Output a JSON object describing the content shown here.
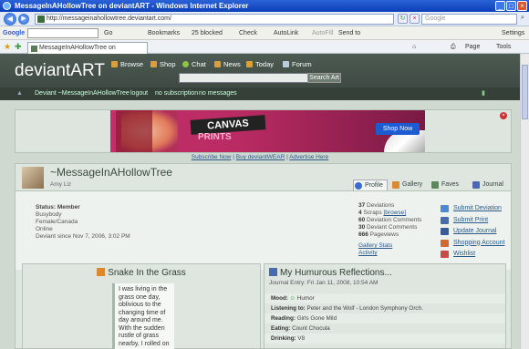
{
  "window": {
    "title": "MessageInAHollowTree on deviantART - Windows Internet Explorer"
  },
  "address": {
    "url": "http://messageinahollowtree.deviantart.com/",
    "search_placeholder": "Google"
  },
  "google_bar": {
    "brand": "Google",
    "go": "Go",
    "bookmarks": "Bookmarks",
    "blocked": "25 blocked",
    "check": "Check",
    "autolink": "AutoLink",
    "autofill": "AutoFill",
    "sendto": "Send to",
    "settings": "Settings"
  },
  "tab": {
    "label": "MessageInAHollowTree on deviantART"
  },
  "commands": {
    "page": "Page",
    "tools": "Tools"
  },
  "site": {
    "logo": "deviantART",
    "nav": [
      "Browse",
      "Shop",
      "Chat",
      "News",
      "Today",
      "Forum"
    ],
    "search_button": "Search Art"
  },
  "userbar": {
    "user": "Deviant ~MessageInAHollowTree",
    "logout": "logout",
    "subscription": "no subscription",
    "messages": "no messages"
  },
  "ad": {
    "canvas": "CANVAS",
    "prints": "PRINTS",
    "shop": "Shop Now",
    "links": [
      "Subscribe Now",
      "Buy deviantWEAR",
      "Advertise Here"
    ]
  },
  "profile": {
    "name": "~MessageInAHollowTree",
    "realname": "Amy Liz",
    "tabs": [
      "Profile",
      "Gallery",
      "Faves",
      "Journal"
    ],
    "info": [
      "Status: Member",
      "Busybody",
      "Female/Canada",
      "Online",
      "Deviant since Nov 7, 2006, 3:02 PM"
    ],
    "stats": [
      {
        "n": "37",
        "t": "Deviations"
      },
      {
        "n": "4",
        "t": "Scraps",
        "extra": "[browse]"
      },
      {
        "n": "60",
        "t": "Deviation Comments"
      },
      {
        "n": "30",
        "t": "Deviant Comments"
      },
      {
        "n": "666",
        "t": "Pageviews"
      }
    ],
    "stat_links": [
      "Gallery Stats",
      "Activity"
    ],
    "actions": [
      "Submit Deviation",
      "Submit Print",
      "Update Journal",
      "Shopping Account",
      "Wishlist"
    ]
  },
  "featured": {
    "title": "Snake In the Grass",
    "text": "I was living in the grass one day, oblivious to the changing time of day around me. With the sudden rustle of grass nearby, I rolled on"
  },
  "journal": {
    "title": "My Humurous Reflections...",
    "date": "Journal Entry: Fri Jan 11, 2008, 10:54 AM",
    "rows": [
      {
        "k": "Mood:",
        "v": "Humor"
      },
      {
        "k": "Listening to:",
        "v": "Peter and the Wolf - London Symphony Orch."
      },
      {
        "k": "Reading:",
        "v": "Girls Gone Mild"
      },
      {
        "k": "Eating:",
        "v": "Count Chocula"
      },
      {
        "k": "Drinking:",
        "v": "V8"
      }
    ]
  },
  "colors": {
    "header": "#4d5b52",
    "page_bg": "#cfd9d0",
    "link": "#2a5a8a",
    "ad_pink": "#c0306a"
  }
}
